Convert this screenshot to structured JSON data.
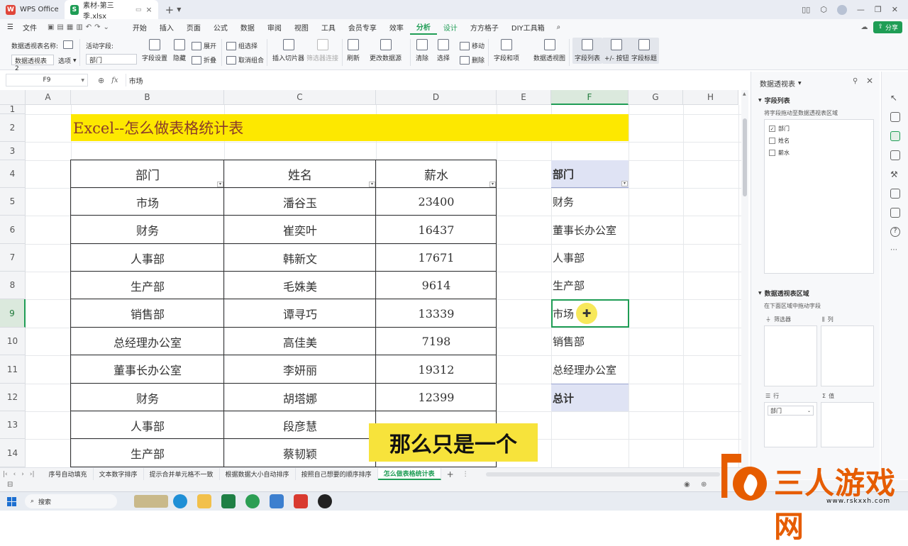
{
  "titlebar": {
    "tabs": [
      {
        "label": "WPS Office"
      },
      {
        "label": "素材-第三季.xlsx"
      }
    ],
    "new_tab": "+"
  },
  "menubar": {
    "file": "文件",
    "items": [
      "开始",
      "插入",
      "页面",
      "公式",
      "数据",
      "审阅",
      "视图",
      "工具",
      "会员专享",
      "效率",
      "分析",
      "设计",
      "方方格子",
      "DIY工具箱"
    ],
    "active": "分析",
    "share": "分享"
  },
  "ribbon": {
    "pivot_name_label": "数据透视表名称:",
    "pivot_name_value": "数据透视表2",
    "options_label": "选项",
    "active_field_label": "活动字段:",
    "active_field_value": "部门",
    "field_settings": "字段设置",
    "hide": "隐藏",
    "expand": "展开",
    "collapse": "折叠",
    "group_selection": "组选择",
    "ungroup": "取消组合",
    "insert_slicer": "插入切片器",
    "filter_connections": "筛选器连接",
    "refresh": "刷新",
    "change_source": "更改数据源",
    "clear": "清除",
    "select": "选择",
    "move": "移动",
    "delete": "删除",
    "fields_items": "字段和项",
    "pivot_chart": "数据透视图",
    "field_list": "字段列表",
    "plus_minus": "+/- 按钮",
    "field_headers": "字段标题"
  },
  "formulabar": {
    "cell_ref": "F9",
    "fx": "fx",
    "content": "市场"
  },
  "sheet": {
    "columns": [
      "A",
      "B",
      "C",
      "D",
      "E",
      "F",
      "G",
      "H"
    ],
    "selected_col": "F",
    "rows": [
      "1",
      "2",
      "3",
      "4",
      "5",
      "6",
      "7",
      "8",
      "9",
      "10",
      "11",
      "12",
      "13",
      "14"
    ],
    "selected_row": "9",
    "title": "Excel--怎么做表格统计表",
    "table": {
      "headers": [
        "部门",
        "姓名",
        "薪水"
      ],
      "rows": [
        [
          "市场",
          "潘谷玉",
          "23400"
        ],
        [
          "财务",
          "崔奕叶",
          "16437"
        ],
        [
          "人事部",
          "韩新文",
          "17671"
        ],
        [
          "生产部",
          "毛姝美",
          "9614"
        ],
        [
          "销售部",
          "谭寻巧",
          "13339"
        ],
        [
          "总经理办公室",
          "高佳美",
          "7198"
        ],
        [
          "董事长办公室",
          "李妍丽",
          "19312"
        ],
        [
          "财务",
          "胡塔娜",
          "12399"
        ],
        [
          "人事部",
          "段彦慧",
          ""
        ],
        [
          "生产部",
          "蔡韧颖",
          ""
        ]
      ]
    },
    "pivot": {
      "header": "部门",
      "items": [
        "财务",
        "董事长办公室",
        "人事部",
        "生产部",
        "市场",
        "销售部",
        "总经理办公室"
      ],
      "total": "总计"
    }
  },
  "sidepanel": {
    "title": "数据透视表",
    "field_list_title": "字段列表",
    "field_list_hint": "将字段拖动至数据透视表区域",
    "fields": [
      {
        "label": "部门",
        "checked": true
      },
      {
        "label": "姓名",
        "checked": false
      },
      {
        "label": "薪水",
        "checked": false
      }
    ],
    "areas_title": "数据透视表区域",
    "areas_hint": "在下面区域中拖动字段",
    "filter_label": "筛选器",
    "columns_label": "列",
    "rows_label": "行",
    "values_label": "值",
    "row_field": "部门"
  },
  "sheettabs": {
    "tabs": [
      "序号自动填充",
      "文本数字排序",
      "提示合并单元格不一致",
      "根据数据大小自动排序",
      "按照自己想要的顺序排序",
      "怎么做表格统计表"
    ],
    "active": "怎么做表格统计表",
    "add": "+"
  },
  "taskbar": {
    "search": "搜索"
  },
  "overlay": {
    "subtitle": "那么只是一个",
    "watermark_text": "三人游戏网",
    "watermark_url": "www.rskxxh.com"
  },
  "colors": {
    "accent_green": "#1f9d55",
    "title_bg": "#fde800",
    "pivot_header_bg": "#dfe3f4",
    "subtitle_bg": "#f7e33b",
    "watermark_orange": "#e65c00"
  }
}
